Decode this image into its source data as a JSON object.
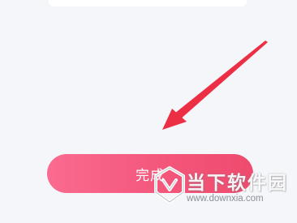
{
  "screen": {
    "background_color": "#f4f6f9"
  },
  "done_button": {
    "label": "完成",
    "gradient_start": "#fa6a90",
    "gradient_end": "#ee4b6e",
    "text_color": "#ffffff"
  },
  "annotation": {
    "icon": "red-arrow-icon",
    "color": "#ec2f45"
  },
  "watermark": {
    "icon": "downxia-logo-icon",
    "title": "当下软件园",
    "url": "www.downxia.com"
  }
}
